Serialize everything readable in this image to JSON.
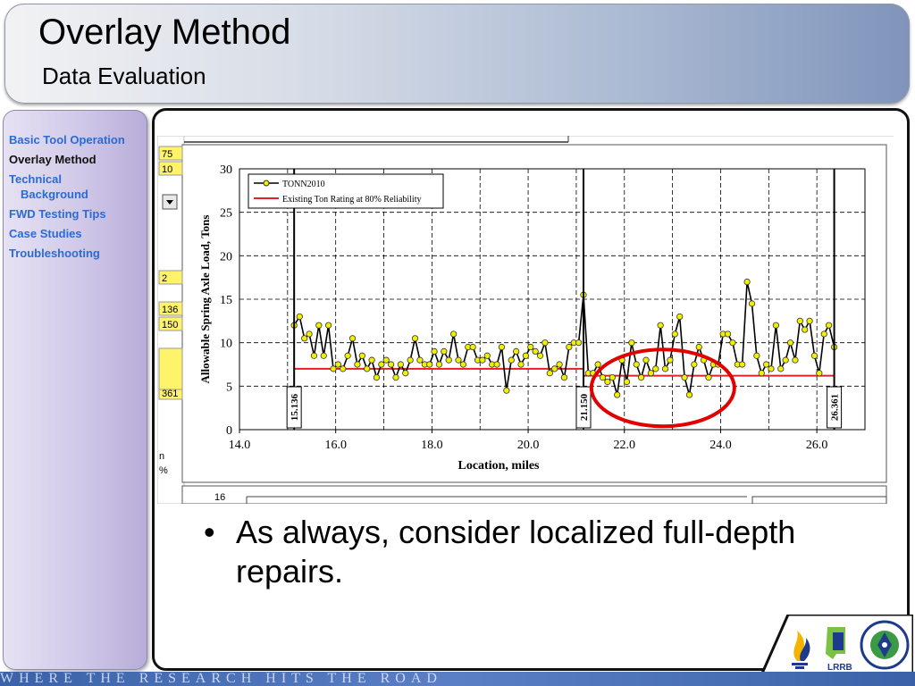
{
  "header": {
    "title": "Overlay Method",
    "subtitle": "Data Evaluation"
  },
  "sidebar": {
    "items": [
      {
        "label": "Basic Tool Operation",
        "active": false
      },
      {
        "label": "Overlay Method",
        "active": true
      },
      {
        "label": "Technical",
        "label2": "Background",
        "active": false
      },
      {
        "label": "FWD Testing Tips",
        "active": false
      },
      {
        "label": "Case Studies",
        "active": false
      },
      {
        "label": "Troubleshooting",
        "active": false
      }
    ]
  },
  "spreadsheet": {
    "left_cells": [
      "75",
      "10",
      "2",
      "136",
      "150",
      "361"
    ],
    "partial_labels": [
      "n",
      "%"
    ],
    "lower_axis_value": "16"
  },
  "chart_data": {
    "type": "line",
    "xlabel": "Location, miles",
    "ylabel": "Allowable Spring Axle Load, Tons",
    "xlim": [
      14.0,
      27.0
    ],
    "ylim": [
      0,
      30
    ],
    "xticks": [
      "14.0",
      "16.0",
      "18.0",
      "20.0",
      "22.0",
      "24.0",
      "26.0"
    ],
    "yticks": [
      "0",
      "5",
      "10",
      "15",
      "20",
      "25",
      "30"
    ],
    "grid": true,
    "legend_placement": "top-left",
    "series": [
      {
        "name": "TONN2010",
        "color": "#000000",
        "marker_color": "#f0f000",
        "x": [
          15.136,
          15.25,
          15.35,
          15.45,
          15.55,
          15.65,
          15.75,
          15.85,
          15.95,
          16.05,
          16.15,
          16.25,
          16.35,
          16.45,
          16.55,
          16.65,
          16.75,
          16.85,
          16.95,
          17.05,
          17.15,
          17.25,
          17.35,
          17.45,
          17.55,
          17.65,
          17.75,
          17.85,
          17.95,
          18.05,
          18.15,
          18.25,
          18.35,
          18.45,
          18.55,
          18.65,
          18.75,
          18.85,
          18.95,
          19.05,
          19.15,
          19.25,
          19.35,
          19.45,
          19.55,
          19.65,
          19.75,
          19.85,
          19.95,
          20.05,
          20.15,
          20.25,
          20.35,
          20.45,
          20.55,
          20.65,
          20.75,
          20.85,
          20.95,
          21.05,
          21.15,
          21.25,
          21.35,
          21.45,
          21.55,
          21.65,
          21.75,
          21.85,
          21.95,
          22.05,
          22.15,
          22.25,
          22.35,
          22.45,
          22.55,
          22.65,
          22.75,
          22.85,
          22.95,
          23.05,
          23.15,
          23.25,
          23.35,
          23.45,
          23.55,
          23.65,
          23.75,
          23.85,
          23.95,
          24.05,
          24.15,
          24.25,
          24.35,
          24.45,
          24.55,
          24.65,
          24.75,
          24.85,
          24.95,
          25.05,
          25.15,
          25.25,
          25.35,
          25.45,
          25.55,
          25.65,
          25.75,
          25.85,
          25.95,
          26.05,
          26.15,
          26.25,
          26.361
        ],
        "y": [
          12.0,
          13.0,
          10.5,
          11.0,
          8.5,
          12.0,
          8.5,
          12.0,
          7.0,
          7.5,
          7.0,
          8.5,
          10.5,
          7.5,
          8.5,
          7.0,
          8.0,
          6.0,
          7.5,
          8.0,
          7.5,
          6.0,
          7.5,
          6.5,
          8.0,
          10.5,
          8.0,
          7.5,
          7.5,
          9.0,
          7.5,
          9.0,
          8.0,
          11.0,
          8.0,
          7.5,
          9.5,
          9.5,
          8.0,
          8.0,
          8.5,
          7.5,
          7.5,
          9.5,
          4.5,
          8.0,
          9.0,
          7.5,
          8.5,
          9.5,
          9.0,
          8.5,
          10.0,
          6.5,
          7.0,
          7.5,
          6.0,
          9.5,
          10.0,
          10.0,
          15.5,
          6.5,
          6.5,
          7.5,
          6.0,
          5.5,
          6.0,
          4.0,
          8.0,
          5.5,
          10.0,
          7.5,
          6.0,
          8.0,
          6.5,
          7.0,
          12.0,
          7.0,
          8.0,
          11.0,
          13.0,
          6.0,
          4.0,
          7.5,
          9.5,
          8.0,
          6.0,
          7.5,
          7.5,
          11.0,
          11.0,
          10.0,
          7.5,
          7.5,
          17.0,
          14.5,
          8.5,
          6.5,
          7.5,
          7.0,
          12.0,
          7.0,
          8.0,
          10.0,
          8.0,
          12.5,
          11.5,
          12.5,
          8.5,
          6.5,
          11.0,
          12.0,
          9.5
        ]
      },
      {
        "name": "Existing Ton Rating at 80% Reliability",
        "color": "#e0202a",
        "segments": [
          [
            15.136,
            21.15,
            7.0
          ],
          [
            21.15,
            26.361,
            6.2
          ]
        ]
      }
    ],
    "vertical_markers": [
      {
        "x": 15.136,
        "label": "15.136"
      },
      {
        "x": 21.15,
        "label": "21.150"
      },
      {
        "x": 26.361,
        "label": "26.361"
      }
    ],
    "annotation": {
      "type": "ellipse",
      "color": "#e00000",
      "center_x": 22.8,
      "center_y": 4.8
    }
  },
  "bullet": {
    "text": "As always, consider localized full-depth repairs."
  },
  "footer": {
    "text": "WHERE THE RESEARCH HITS THE ROAD"
  },
  "logos": [
    "flame-icon",
    "lrrb-logo",
    "mndot-seal"
  ],
  "colors": {
    "accent": "#2a6bd6",
    "rating_line": "#e0202a",
    "marker": "#f0f000",
    "circle": "#e00000"
  }
}
